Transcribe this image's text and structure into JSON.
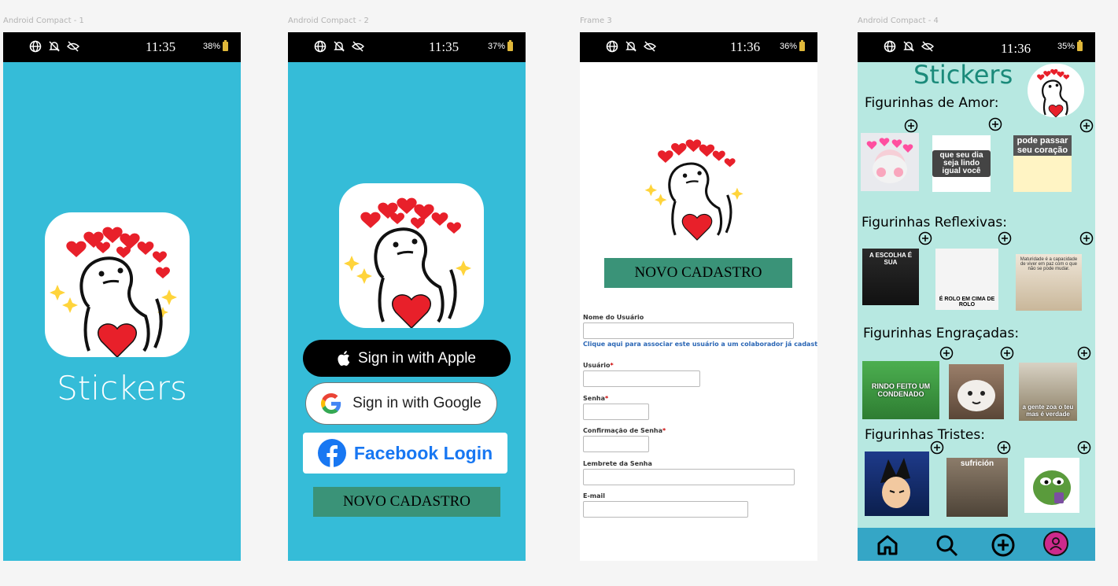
{
  "frames": [
    {
      "label": "Android Compact - 1",
      "time": "11:35",
      "battery": "38%"
    },
    {
      "label": "Android Compact - 2",
      "time": "11:35",
      "battery": "37%"
    },
    {
      "label": "Frame 3",
      "time": "11:36",
      "battery": "36%"
    },
    {
      "label": "Android Compact - 4",
      "time": "11:36",
      "battery": "35%"
    }
  ],
  "splash": {
    "title": "Stickers"
  },
  "login": {
    "apple": "Sign in with Apple",
    "google": "Sign in with Google",
    "facebook": "Facebook Login",
    "novo": "NOVO CADASTRO"
  },
  "register": {
    "novo": "NOVO CADASTRO",
    "nome_label": "Nome do Usuário",
    "link": "Clique aqui para associar este usuário a um colaborador já cadastrado",
    "usuario_label": "Usuário",
    "senha_label": "Senha",
    "confirmacao_label": "Confirmação de Senha",
    "lembrete_label": "Lembrete da Senha",
    "email_label": "E-mail",
    "req_mark": "*"
  },
  "stickers": {
    "title": "Stickers",
    "sections": [
      {
        "title": "Figurinhas de Amor:",
        "texts": [
          "",
          "que seu dia seja lindo igual você",
          "pode passar seu coração"
        ]
      },
      {
        "title": "Figurinhas Reflexivas:",
        "texts": [
          "A ESCOLHA É SUA",
          "É ROLO EM CIMA DE ROLO",
          "Maturidade é a capacidade de viver em paz com o que não se pode mudar."
        ]
      },
      {
        "title": "Figurinhas Engraçadas:",
        "texts": [
          "RINDO FEITO UM CONDENADO",
          "",
          "a gente zoa o teu mas é verdade"
        ]
      },
      {
        "title": "Figurinhas Tristes:",
        "texts": [
          "",
          "sufrición",
          ""
        ]
      }
    ]
  },
  "colors": {
    "primary": "#35bcd8",
    "button_green": "#3a9378",
    "mint": "#b7e8e1",
    "title_teal": "#1a8a7a",
    "nav": "#35a6c6"
  }
}
